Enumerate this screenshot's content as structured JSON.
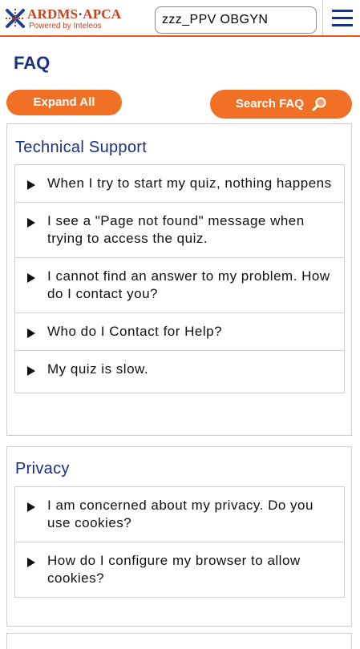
{
  "header": {
    "logo_main": "ARDMS",
    "logo_sep": "·",
    "logo_second": "APCA",
    "logo_sub": "Powered by Inteleos",
    "exam_value": "zzz_PPV OBGYN",
    "menu_icon": "hamburger-menu-icon"
  },
  "page": {
    "title": "FAQ",
    "expand_label": "Expand All",
    "search_label": "Search FAQ",
    "search_icon": "magnifier-icon"
  },
  "sections": [
    {
      "title": "Technical Support",
      "questions": [
        "When I try to start my quiz, nothing happens",
        "I see a \"Page not found\" message when trying to access the quiz.",
        "I cannot find an answer to my problem. How do I contact you?",
        "Who do I Contact for Help?",
        "My quiz is slow."
      ]
    },
    {
      "title": "Privacy",
      "questions": [
        "I am concerned about my privacy. Do you use cookies?",
        "How do I configure my browser to allow cookies?"
      ]
    }
  ],
  "colors": {
    "brand_orange": "#f07026",
    "brand_navy": "#1a2f86",
    "logo_red": "#c8401f"
  }
}
